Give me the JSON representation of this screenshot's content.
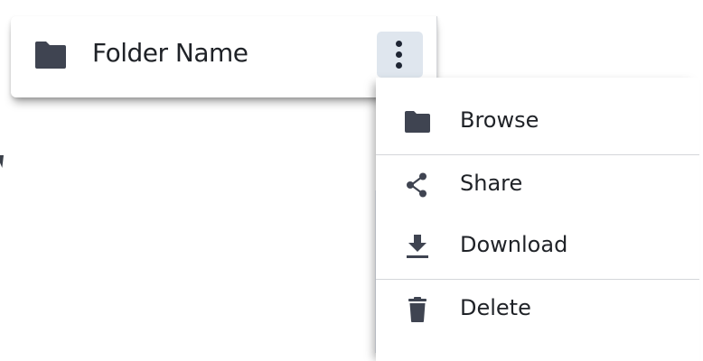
{
  "folder_card": {
    "name": "Folder Name",
    "icon": "folder-icon",
    "menu_button_icon": "more-vertical-icon"
  },
  "menu": {
    "items": [
      {
        "label": "Browse",
        "icon": "folder-icon"
      },
      {
        "label": "Share",
        "icon": "share-icon"
      },
      {
        "label": "Download",
        "icon": "download-icon"
      },
      {
        "label": "Delete",
        "icon": "trash-icon"
      }
    ]
  },
  "colors": {
    "icon": "#3f4451",
    "text": "#1f2227",
    "menu_button_bg": "#dfe6ee",
    "divider": "#d4d6da"
  }
}
